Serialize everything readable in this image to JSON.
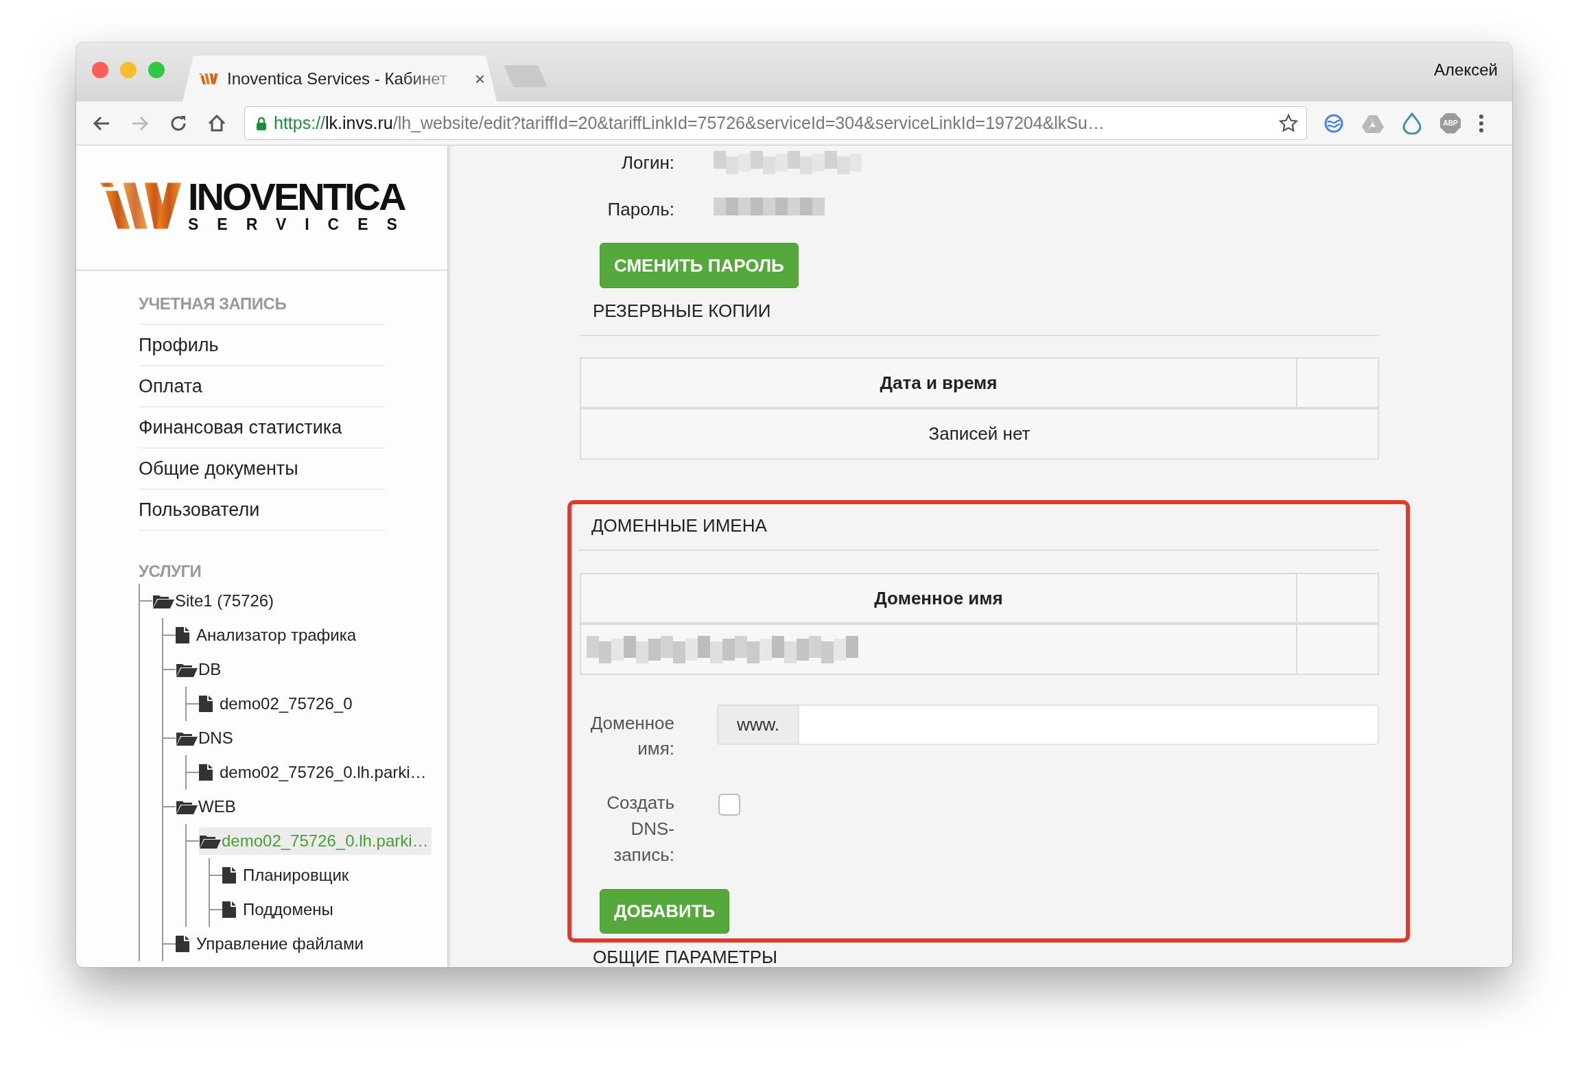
{
  "browser": {
    "tab": {
      "title": "Inoventica Services - Кабинет",
      "close": "×"
    },
    "profile": "Алексей",
    "address": {
      "scheme": "https://",
      "host": "lk.invs.ru",
      "path": "/lh_website/edit?tariffId=20&tariffLinkId=75726&serviceId=304&serviceLinkId=197204&lkSu…"
    },
    "adblock_label": "ABP"
  },
  "sidebar": {
    "logo": {
      "name": "INOVENTICA",
      "tagline": "SERVICES"
    },
    "account": {
      "title": "УЧЕТНАЯ ЗАПИСЬ",
      "items": [
        {
          "label": "Профиль"
        },
        {
          "label": "Оплата"
        },
        {
          "label": "Финансовая статистика"
        },
        {
          "label": "Общие документы"
        },
        {
          "label": "Пользователи"
        }
      ]
    },
    "services": {
      "title": "УСЛУГИ",
      "tree": [
        {
          "kind": "folder",
          "label": "Site1 (75726)",
          "selected": false,
          "children": [
            {
              "kind": "file",
              "label": "Анализатор трафика",
              "selected": false
            },
            {
              "kind": "folder",
              "label": "DB",
              "selected": false,
              "children": [
                {
                  "kind": "file",
                  "label": "demo02_75726_0",
                  "selected": false
                }
              ]
            },
            {
              "kind": "folder",
              "label": "DNS",
              "selected": false,
              "children": [
                {
                  "kind": "file",
                  "label": "demo02_75726_0.lh.parki…",
                  "selected": false
                }
              ]
            },
            {
              "kind": "folder",
              "label": "WEB",
              "selected": false,
              "children": [
                {
                  "kind": "folder",
                  "label": "demo02_75726_0.lh.parki…",
                  "selected": true,
                  "children": [
                    {
                      "kind": "file",
                      "label": "Планировщик",
                      "selected": false
                    },
                    {
                      "kind": "file",
                      "label": "Поддомены",
                      "selected": false
                    }
                  ]
                }
              ]
            },
            {
              "kind": "file",
              "label": "Управление файлами",
              "selected": false
            }
          ]
        }
      ]
    }
  },
  "main": {
    "credentials": [
      {
        "label": "Логин:"
      },
      {
        "label": "Пароль:"
      }
    ],
    "change_password_button": "СМЕНИТЬ ПАРОЛЬ",
    "backups": {
      "title": "РЕЗЕРВНЫЕ КОПИИ",
      "columns": [
        "Дата и время"
      ],
      "empty_message": "Записей нет"
    },
    "domains": {
      "title": "ДОМЕННЫЕ ИМЕНА",
      "highlighted": true,
      "columns": [
        "Доменное имя"
      ],
      "form": {
        "domain_label": "Доменное имя:",
        "prefix": "www.",
        "create_dns_label": "Создать DNS-запись:",
        "create_dns_checked": false
      },
      "add_button": "ДОБАВИТЬ"
    },
    "general": {
      "title": "ОБЩИЕ ПАРАМЕТРЫ"
    }
  }
}
